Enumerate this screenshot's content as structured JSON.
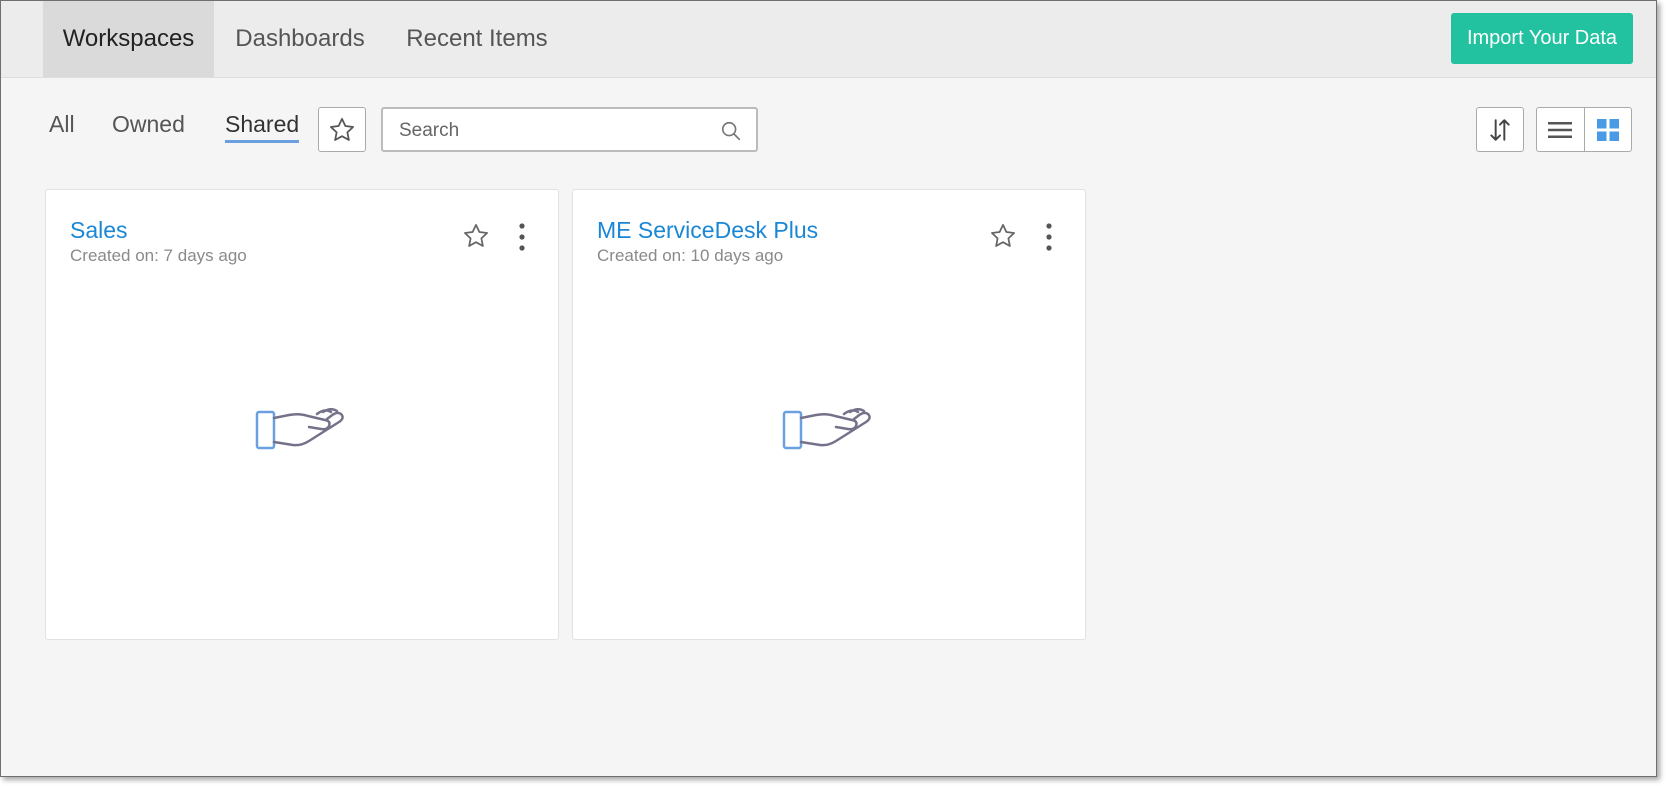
{
  "tabs": [
    {
      "label": "Workspaces",
      "active": true
    },
    {
      "label": "Dashboards",
      "active": false
    },
    {
      "label": "Recent Items",
      "active": false
    }
  ],
  "import_button": "Import Your Data",
  "filters": [
    {
      "label": "All",
      "active": false
    },
    {
      "label": "Owned",
      "active": false
    },
    {
      "label": "Shared",
      "active": true
    }
  ],
  "search": {
    "placeholder": "Search",
    "value": ""
  },
  "workspaces": [
    {
      "title": "Sales",
      "created": "Created on: 7 days ago"
    },
    {
      "title": "ME ServiceDesk Plus",
      "created": "Created on: 10 days ago"
    }
  ],
  "colors": {
    "accent": "#22c1a0",
    "link": "#1a87d6",
    "active_underline": "#6aa0e0",
    "grid_icon": "#4a9be6",
    "hand_outline": "#76718a",
    "cuff": "#6aa0e0"
  },
  "icons": {
    "favorites": "star-icon",
    "search": "search-icon",
    "sort": "sort-icon",
    "list_view": "list-view-icon",
    "grid_view": "grid-view-icon",
    "card_menu": "more-vertical-icon",
    "card_art": "open-hand-icon"
  }
}
